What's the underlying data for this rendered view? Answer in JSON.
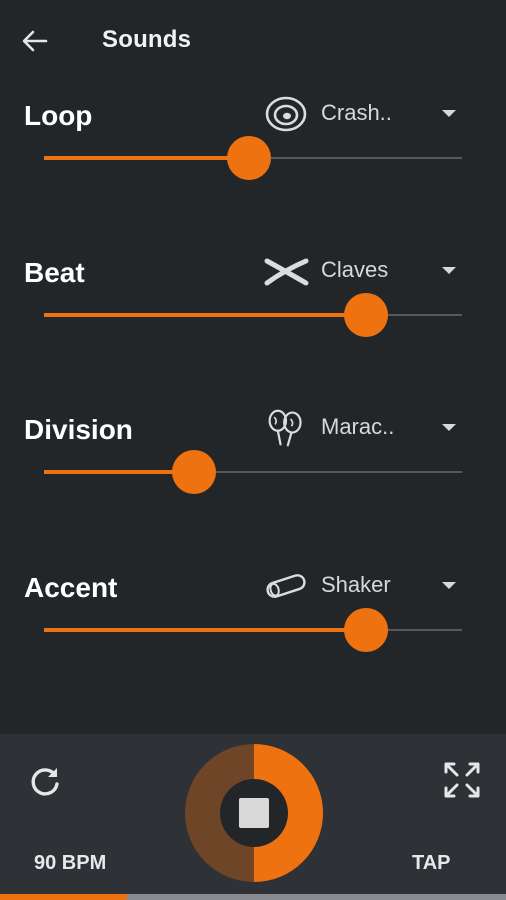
{
  "header": {
    "title": "Sounds"
  },
  "sections": [
    {
      "label": "Loop",
      "sound": "Crash..",
      "icon": "cymbal-icon",
      "level": 0.49
    },
    {
      "label": "Beat",
      "sound": "Claves",
      "icon": "claves-icon",
      "level": 0.77
    },
    {
      "label": "Division",
      "sound": "Marac..",
      "icon": "maracas-icon",
      "level": 0.36
    },
    {
      "label": "Accent",
      "sound": "Shaker",
      "icon": "shaker-icon",
      "level": 0.77
    }
  ],
  "footer": {
    "bpm": "90 BPM",
    "tap": "TAP",
    "play_progress": 0.5,
    "beat_progress": 0.25
  },
  "colors": {
    "accent": "#ef7211",
    "accent_dark": "#6e4526",
    "background": "#232629",
    "footer": "#2e3135"
  }
}
